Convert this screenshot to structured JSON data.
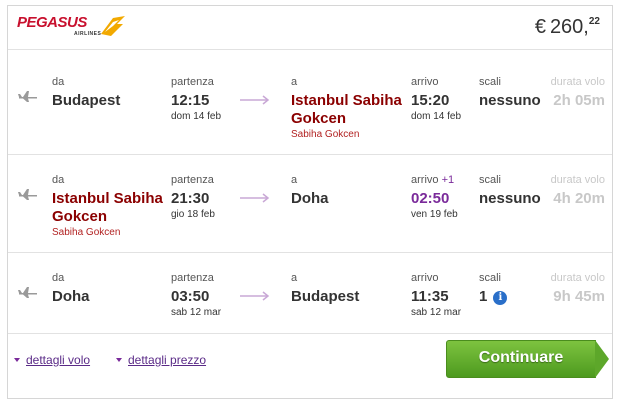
{
  "header": {
    "airline_logo_text": "PEGASUS",
    "airline_logo_sub": "AIRLINES",
    "price_currency": "€",
    "price_main": "260,",
    "price_cents": "22"
  },
  "labels": {
    "from": "da",
    "departure": "partenza",
    "to": "a",
    "arrival": "arrivo",
    "stops": "scali",
    "duration": "durata volo"
  },
  "legs": [
    {
      "from_city": "Budapest",
      "dep_time": "12:15",
      "dep_date": "dom 14 feb",
      "to_city": "Istanbul Sabiha Gokcen",
      "to_city_line1": "Istanbul Sabiha",
      "to_city_line2": "Gokcen",
      "to_sub": "Sabiha Gokcen",
      "arr_time": "15:20",
      "arr_date": "dom 14 feb",
      "stops": "nessuno",
      "duration": "2h 05m"
    },
    {
      "from_city_line1": "Istanbul Sabiha",
      "from_city_line2": "Gokcen",
      "from_sub": "Sabiha Gokcen",
      "dep_time": "21:30",
      "dep_date": "gio 18 feb",
      "to_city": "Doha",
      "arr_plus": "+1",
      "arr_time": "02:50",
      "arr_date": "ven 19 feb",
      "stops": "nessuno",
      "duration": "4h 20m"
    },
    {
      "from_city": "Doha",
      "dep_time": "03:50",
      "dep_date": "sab 12 mar",
      "to_city": "Budapest",
      "arr_time": "11:35",
      "arr_date": "sab 12 mar",
      "stops": "1",
      "duration": "9h 45m"
    }
  ],
  "footer": {
    "flight_details": "dettagli volo",
    "price_details": "dettagli prezzo",
    "continue": "Continuare"
  },
  "colors": {
    "brand_red": "#c8102e",
    "dest_red": "#8b0000",
    "next_day_purple": "#7a2a9a",
    "cta_green": "#5da72a",
    "info_blue": "#2a6fc9"
  },
  "icons": [
    "pegasus-wing-icon",
    "plane-icon",
    "right-arrow-icon",
    "info-icon",
    "caret-down-icon"
  ]
}
